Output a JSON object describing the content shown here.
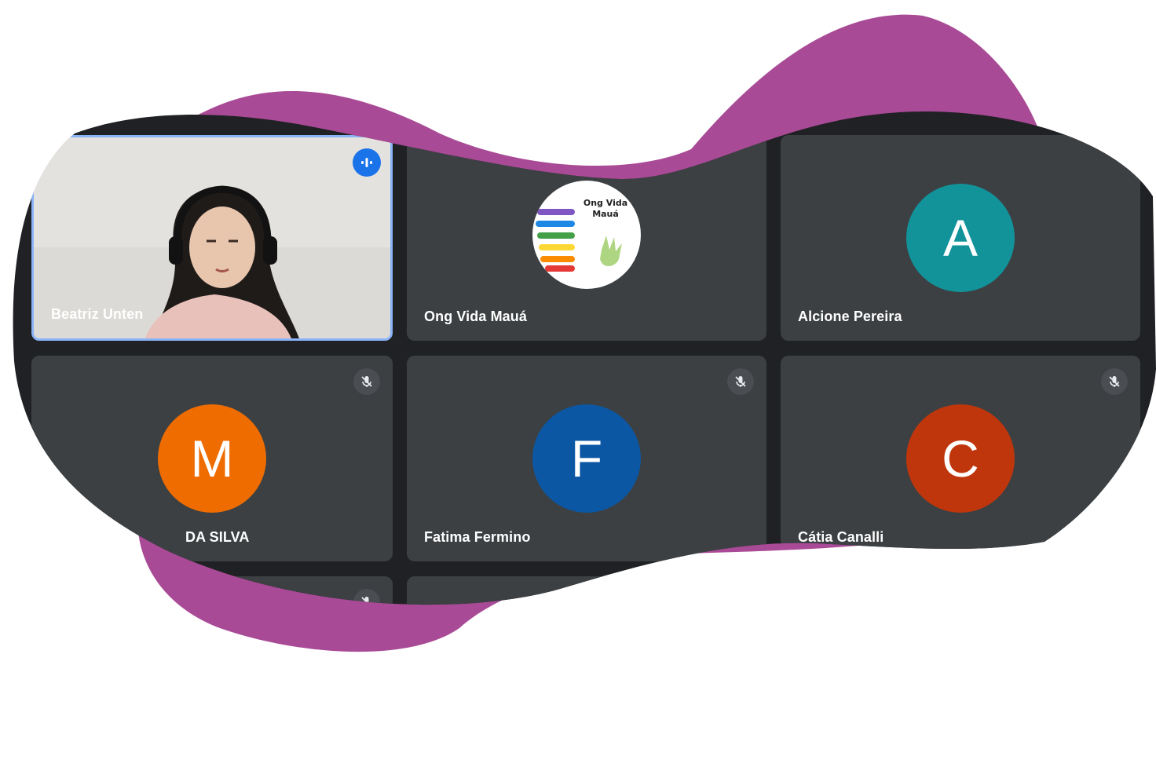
{
  "meeting": {
    "participants": [
      {
        "name": "Beatriz Unten",
        "type": "video",
        "speaking": true
      },
      {
        "name": "Ong Vida Mauá",
        "type": "logo",
        "logo_text": "Ong Vida Mauá"
      },
      {
        "name": "Alcione Pereira",
        "type": "avatar",
        "initial": "A",
        "color": "#12939a"
      },
      {
        "name": "DA SILVA",
        "type": "avatar",
        "initial": "M",
        "color": "#ef6c00",
        "muted": true
      },
      {
        "name": "Fatima Fermino",
        "type": "avatar",
        "initial": "F",
        "color": "#0b57a4",
        "muted": true
      },
      {
        "name": "Cátia Canalli",
        "type": "avatar",
        "initial": "C",
        "color": "#bf360c",
        "muted": true
      }
    ]
  },
  "decor": {
    "blob_color": "#a94a96",
    "tile_color": "#3c4043",
    "speaking_color": "#1a73e8"
  }
}
